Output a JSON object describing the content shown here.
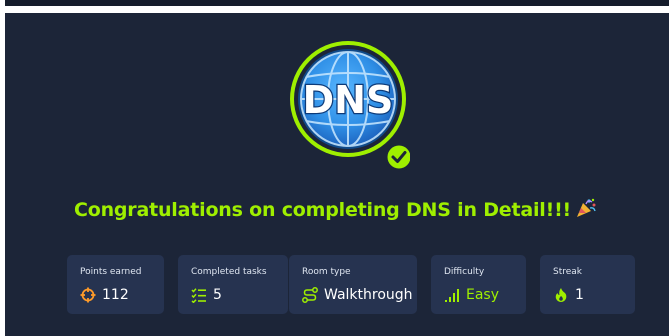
{
  "badge": {
    "text": "DNS",
    "status_icon": "check-circle-icon"
  },
  "headline": {
    "text": "Congratulations on completing DNS in Detail!!!",
    "emoji_icon": "party-popper-icon"
  },
  "stats": [
    {
      "label": "Points earned",
      "value": "112",
      "icon": "crosshair-icon"
    },
    {
      "label": "Completed tasks",
      "value": "5",
      "icon": "checklist-icon"
    },
    {
      "label": "Room type",
      "value": "Walkthrough",
      "icon": "route-icon"
    },
    {
      "label": "Difficulty",
      "value": "Easy",
      "icon": "signal-bars-icon"
    },
    {
      "label": "Streak",
      "value": "1",
      "icon": "flame-icon"
    }
  ],
  "colors": {
    "background": "#1c2538",
    "card": "#263350",
    "accent": "#9fef00",
    "icon_orange": "#ff9b29",
    "globe_blue": "#2f8fe6"
  }
}
